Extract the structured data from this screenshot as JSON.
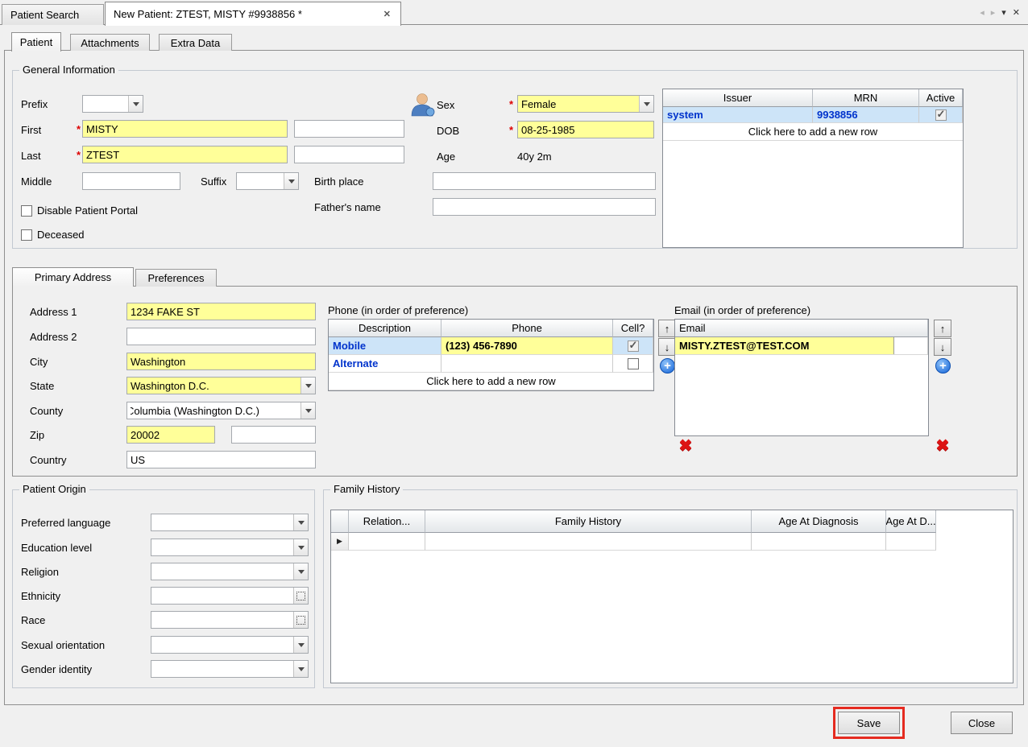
{
  "colors": {
    "highlight": "#ffff99",
    "selected_row": "#cde4f8",
    "link_blue": "#0033cc",
    "annotation_red": "#e52b20",
    "required_red": "#dd0000"
  },
  "icons": {
    "close": "✕",
    "scroll_left": "◂",
    "scroll_right": "▸",
    "menu_down": "▾",
    "move_up": "↑",
    "move_down": "↓",
    "add": "+",
    "delete": "✖",
    "row_selector": "▶"
  },
  "top_tabs": {
    "patient_search": "Patient Search",
    "new_patient": "New Patient: ZTEST, MISTY #9938856 *"
  },
  "sub_tabs": [
    "Patient",
    "Attachments",
    "Extra Data"
  ],
  "general": {
    "title": "General Information",
    "required_marker": "*",
    "prefix_label": "Prefix",
    "first_label": "First",
    "first_value": "MISTY",
    "last_label": "Last",
    "last_value": "ZTEST",
    "middle_label": "Middle",
    "suffix_label": "Suffix",
    "sex_label": "Sex",
    "sex_value": "Female",
    "dob_label": "DOB",
    "dob_value": "08-25-1985",
    "age_label": "Age",
    "age_value": "40y 2m",
    "birth_place_label": "Birth place",
    "fathers_name_label": "Father's name",
    "disable_portal_label": "Disable Patient Portal",
    "deceased_label": "Deceased",
    "disable_portal_checked": false,
    "deceased_checked": false
  },
  "mrn_table": {
    "headers": [
      "Issuer",
      "MRN",
      "Active"
    ],
    "rows": [
      {
        "issuer": "system",
        "mrn": "9938856",
        "active": true
      }
    ],
    "add_row": "Click here to add a new row"
  },
  "address_tabs": {
    "primary": "Primary Address",
    "preferences": "Preferences"
  },
  "address": {
    "address1_label": "Address 1",
    "address1_value": "1234 FAKE ST",
    "address2_label": "Address 2",
    "address2_value": "",
    "city_label": "City",
    "city_value": "Washington",
    "state_label": "State",
    "state_value": "Washington D.C.",
    "county_label": "County",
    "county_value": "Columbia (Washington D.C.)",
    "zip_label": "Zip",
    "zip_value": "20002",
    "zip_ext_value": "",
    "country_label": "Country",
    "country_value": "US"
  },
  "phone": {
    "title": "Phone (in order of preference)",
    "headers": [
      "Description",
      "Phone",
      "Cell?"
    ],
    "rows": [
      {
        "description": "Mobile",
        "phone": "(123) 456-7890",
        "cell": true
      },
      {
        "description": "Alternate",
        "phone": "",
        "cell": false
      }
    ],
    "add_row": "Click here to add a new row"
  },
  "email": {
    "title": "Email (in order of preference)",
    "header": "Email",
    "rows": [
      {
        "email": "MISTY.ZTEST@TEST.COM"
      }
    ]
  },
  "origin": {
    "title": "Patient Origin",
    "fields": [
      "Preferred language",
      "Education level",
      "Religion",
      "Ethnicity",
      "Race",
      "Sexual orientation",
      "Gender identity"
    ]
  },
  "family_history": {
    "title": "Family History",
    "headers": [
      "Relation...",
      "Family History",
      "Age At Diagnosis",
      "Age At D..."
    ]
  },
  "footer": {
    "save": "Save",
    "close": "Close"
  }
}
